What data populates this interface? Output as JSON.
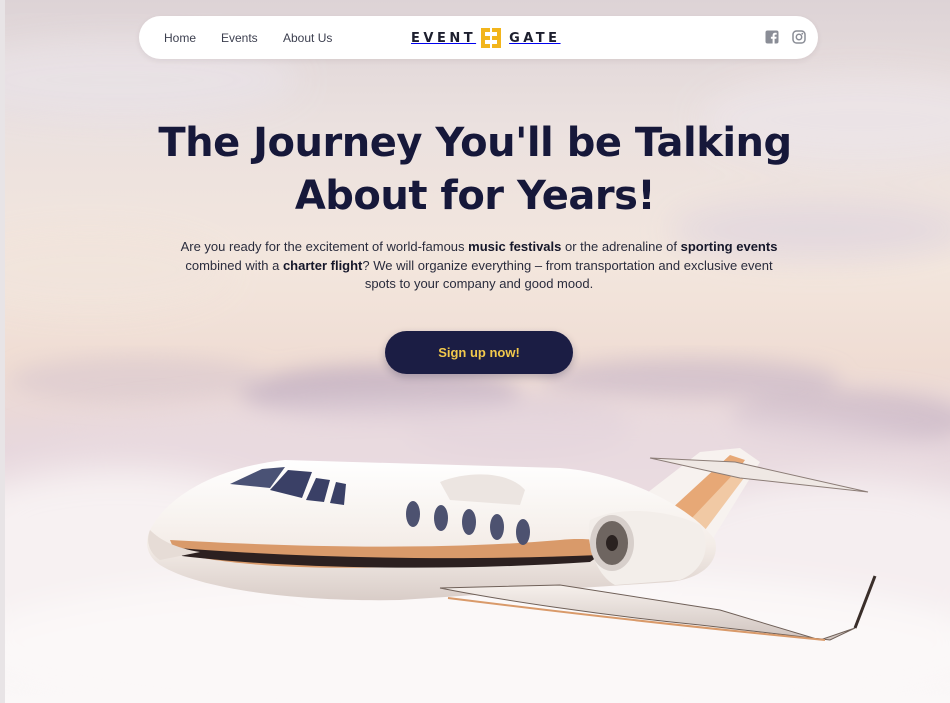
{
  "nav": {
    "links": [
      "Home",
      "Events",
      "About Us"
    ],
    "logo_left": "EVENT",
    "logo_right": "GATE",
    "logo_accent_color": "#f2b51c",
    "social_icons": [
      "facebook-icon",
      "instagram-icon"
    ]
  },
  "hero": {
    "headline_line1": "The Journey You'll be Talking",
    "headline_line2": "About for Years!",
    "lead": {
      "t1": "Are you ready for the excitement of world-famous ",
      "b1": "music festivals",
      "t2": " or the adrenaline of ",
      "b2": "sporting events",
      "t3": " combined with a ",
      "b3": "charter flight",
      "t4": "? We will organize everything – from transportation and exclusive event spots to your company and good mood."
    },
    "cta_label": "Sign up now!"
  },
  "colors": {
    "headline": "#16183a",
    "button_bg": "#1b1d44",
    "button_text": "#f2c94c"
  }
}
